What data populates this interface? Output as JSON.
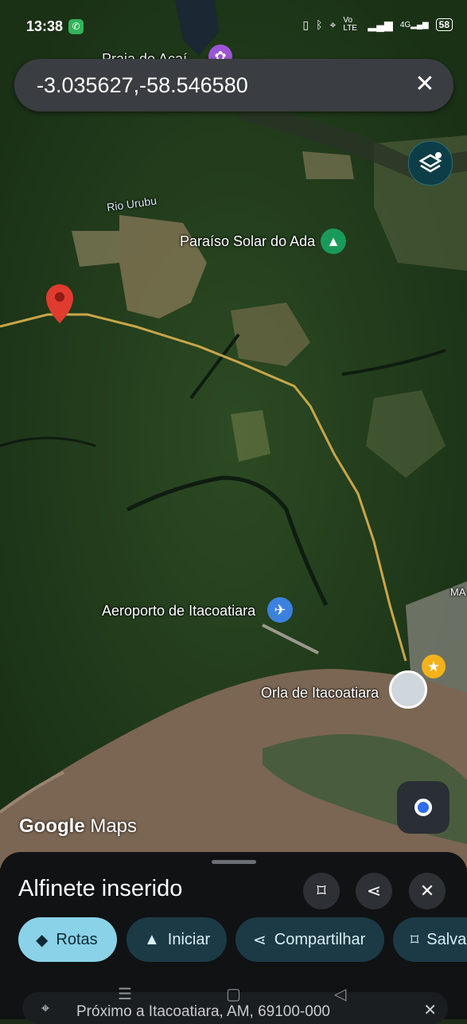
{
  "status_bar": {
    "time": "13:38",
    "right_icons": [
      "vibrate-icon",
      "bluetooth-icon",
      "location-icon",
      "volte-icon",
      "signal-icon",
      "4g-signal-icon"
    ],
    "volte_label": "Vo LTE",
    "network_label": "4G",
    "battery_label": "58"
  },
  "search": {
    "query": "-3.035627,-58.546580"
  },
  "map": {
    "labels": {
      "top_partial": "Praia do Açaí",
      "river": "Rio Urubu",
      "paraiso": "Paraíso Solar do Ada",
      "airport": "Aeroporto de Itacoatiara",
      "orla": "Orla de Itacoatiara",
      "edge": "MA"
    },
    "logo": {
      "google": "Google",
      "maps": "Maps"
    },
    "colors": {
      "forest": "#1f3a1c",
      "river": "#7b6653",
      "road": "#c9a64a",
      "pin": "#e03b2f"
    }
  },
  "sheet": {
    "title": "Alfinete inserido",
    "actions": {
      "rotas": "Rotas",
      "iniciar": "Iniciar",
      "compartilhar": "Compartilhar",
      "salvar": "Salvar"
    },
    "address": "Próximo a Itacoatiara, AM, 69100-000"
  }
}
